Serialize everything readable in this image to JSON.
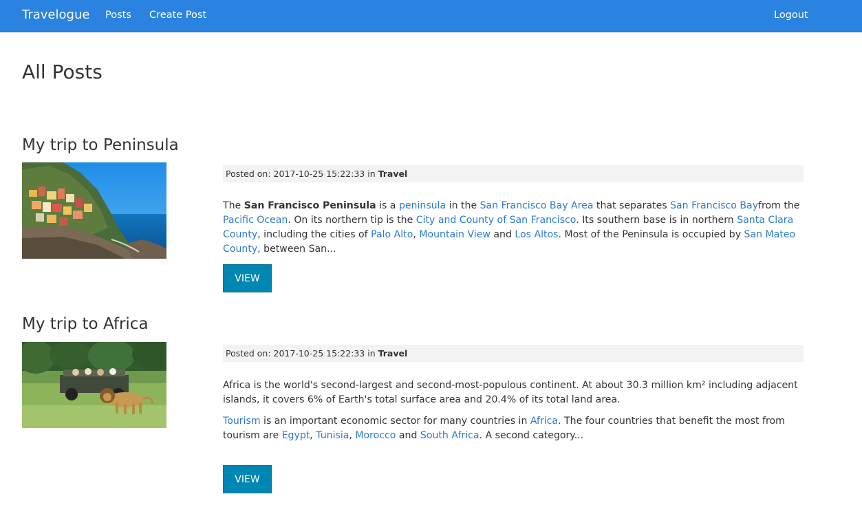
{
  "nav": {
    "brand": "Travelogue",
    "posts": "Posts",
    "create_post": "Create Post",
    "logout": "Logout"
  },
  "page": {
    "title": "All Posts"
  },
  "posts": [
    {
      "title": "My trip to Peninsula",
      "meta": {
        "label": "Posted on: 2017-10-25 15:22:33 in ",
        "category": "Travel"
      },
      "excerpt": {
        "t1": "The ",
        "b1": "San Francisco Peninsula",
        "t2": " is a ",
        "a1": "peninsula",
        "t3": " in the ",
        "a2": "San Francisco Bay Area",
        "t4": " that separates ",
        "a3": "San Francisco Bay",
        "t5": "from the ",
        "a4": "Pacific Ocean",
        "t6": ". On its northern tip is the ",
        "a5": "City and County of San Francisco",
        "t7": ". Its southern base is in northern ",
        "a6": "Santa Clara County",
        "t8": ", including the cities of ",
        "a7": "Palo Alto",
        "t9": ", ",
        "a8": "Mountain View",
        "t10": " and ",
        "a9": "Los Altos",
        "t11": ". Most of the Peninsula is occupied by ",
        "a10": "San Mateo County",
        "t12": ", between San..."
      },
      "view_label": "VIEW"
    },
    {
      "title": "My trip to Africa",
      "meta": {
        "label": "Posted on: 2017-10-25 15:22:33 in ",
        "category": "Travel"
      },
      "excerpt_p1": "Africa is the world's second-largest and second-most-populous continent. At about 30.3 million km² including adjacent islands, it covers 6% of Earth's total surface area and 20.4% of its total land area.",
      "excerpt_p2": {
        "a1": "Tourism",
        "t1": " is an important economic sector for many countries in ",
        "a2": "Africa",
        "t2": ". The four countries that benefit the most from tourism are ",
        "a3": "Egypt",
        "t3": ", ",
        "a4": "Tunisia",
        "t4": ", ",
        "a5": "Morocco",
        "t5": " and ",
        "a6": "South Africa",
        "t6": ". A second category..."
      },
      "view_label": "VIEW"
    }
  ],
  "colors": {
    "navbar": "#2a83e0",
    "link": "#2a7bcc",
    "button": "#0086b3",
    "meta_bg": "#f3f3f3"
  }
}
